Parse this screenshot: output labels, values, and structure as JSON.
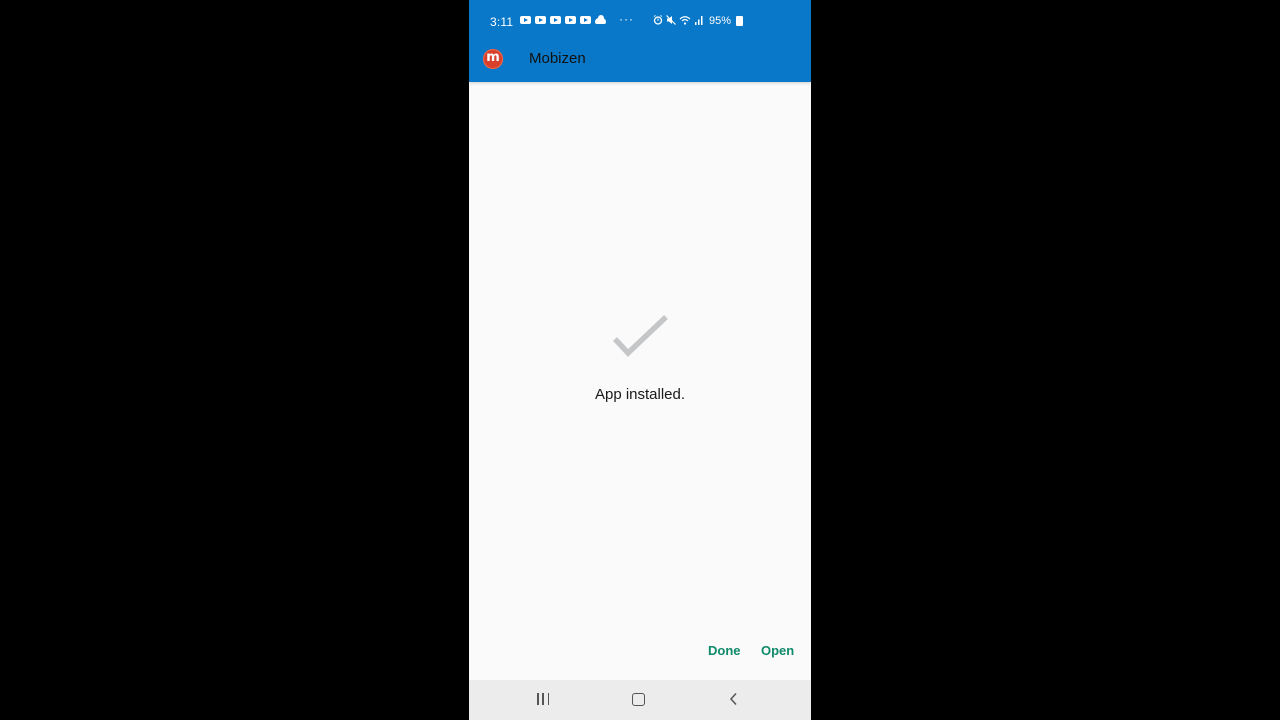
{
  "status_bar": {
    "time": "3:11",
    "battery": "95%",
    "notification_icons": [
      "youtube-icon",
      "youtube-icon",
      "youtube-icon",
      "youtube-icon",
      "youtube-icon",
      "cloud-icon"
    ],
    "overflow": "···"
  },
  "app_bar": {
    "title": "Mobizen",
    "logo_letter": "m",
    "color": "#0a78c8"
  },
  "main": {
    "message": "App installed."
  },
  "actions": {
    "done_label": "Done",
    "open_label": "Open",
    "color": "#0f8a6a"
  },
  "nav_bar": {
    "recents": "recents-icon",
    "home": "home-icon",
    "back": "back-icon"
  }
}
